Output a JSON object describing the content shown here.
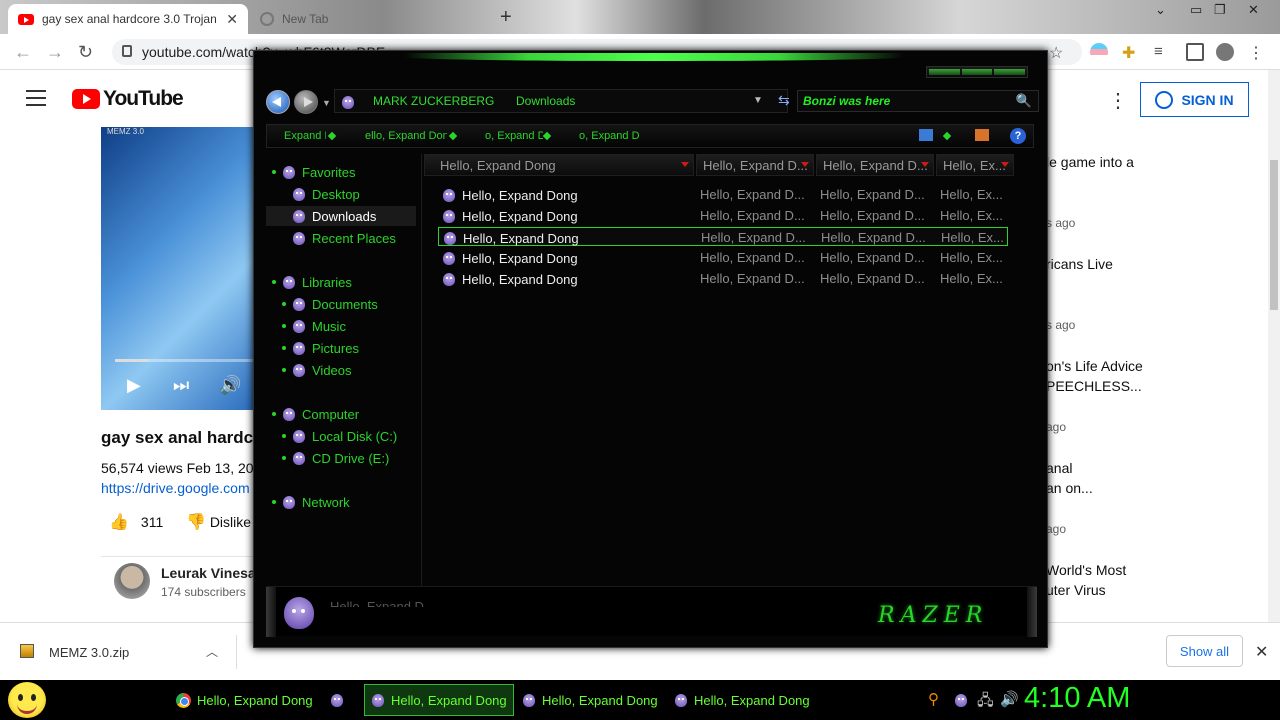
{
  "browser": {
    "tabs": [
      {
        "label": "gay sex anal hardcore 3.0 Trojan",
        "active": true
      },
      {
        "label": "New Tab",
        "active": false
      }
    ],
    "url": "youtube.com/watch?v=wbF6t2WcrDBE"
  },
  "youtube": {
    "logo": "YouTube",
    "signin_label": "SIGN IN",
    "player_watermark": "MEMZ 3.0",
    "video_title": "gay sex anal hardc",
    "stats": "56,574 views  Feb 13, 20",
    "link": "https://drive.google.com",
    "likes": "311",
    "dislike_label": "Dislike",
    "channel_name": "Leurak Vinesau",
    "channel_subs": "174 subscribers",
    "recommendations": [
      {
        "title": "le game into a",
        "meta": "s ago"
      },
      {
        "title": "ricans Live",
        "meta": "s ago"
      },
      {
        "title": "on's Life Advice",
        "title2": "PEECHLESS...",
        "meta": "ago"
      },
      {
        "title": "anal",
        "title2": "an on...",
        "meta": "ago"
      },
      {
        "title": "World's Most",
        "title2": "uter Virus"
      }
    ]
  },
  "downloads": {
    "file": "MEMZ 3.0.zip",
    "show_all": "Show all"
  },
  "explorer": {
    "breadcrumb": [
      "MARK ZUCKERBERG",
      "Downloads"
    ],
    "search_value": "Bonzi was here",
    "commands": [
      "Expand I",
      "ello, Expand Don",
      "o, Expand D",
      "o, Expand D"
    ],
    "help": "?",
    "nav": {
      "favorites": "Favorites",
      "desktop": "Desktop",
      "downloads": "Downloads",
      "recent": "Recent Places",
      "libraries": "Libraries",
      "documents": "Documents",
      "music": "Music",
      "pictures": "Pictures",
      "videos": "Videos",
      "computer": "Computer",
      "local_disk": "Local Disk (C:)",
      "cd_drive": "CD Drive (E:)",
      "network": "Network"
    },
    "columns": [
      "Hello, Expand Dong",
      "Hello, Expand D...",
      "Hello, Expand D...",
      "Hello, Ex..."
    ],
    "files": [
      {
        "name": "Hello, Expand Dong",
        "c2": "Hello, Expand D...",
        "c3": "Hello, Expand D...",
        "c4": "Hello, Ex..."
      },
      {
        "name": "Hello, Expand Dong",
        "c2": "Hello, Expand D...",
        "c3": "Hello, Expand D...",
        "c4": "Hello, Ex..."
      },
      {
        "name": "Hello, Expand Dong",
        "c2": "Hello, Expand D...",
        "c3": "Hello, Expand D...",
        "c4": "Hello, Ex..."
      },
      {
        "name": "Hello, Expand Dong",
        "c2": "Hello, Expand D...",
        "c3": "Hello, Expand D...",
        "c4": "Hello, Ex..."
      },
      {
        "name": "Hello, Expand Dong",
        "c2": "Hello, Expand D...",
        "c3": "Hello, Expand D...",
        "c4": "Hello, Ex..."
      }
    ],
    "details_text": "Hello, Expand D...",
    "brand": "RAZER"
  },
  "taskbar": {
    "items": [
      "Hello, Expand Dong",
      "Hello, Expand Dong",
      "Hello, Expand Dong",
      "Hello, Expand Dong"
    ],
    "clock": "4:10 AM"
  },
  "colors": {
    "accent_green": "#2bd42b",
    "youtube_red": "#ff0000",
    "clock_green": "#22ff22"
  }
}
